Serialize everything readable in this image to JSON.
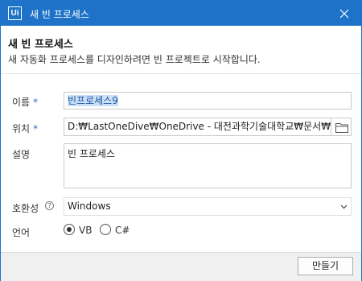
{
  "window": {
    "title": "새 빈 프로세스",
    "logo_text": "Ui"
  },
  "header": {
    "title": "새 빈 프로세스",
    "description": "새 자동화 프로세스를 디자인하려면 빈 프로젝트로 시작합니다."
  },
  "form": {
    "name": {
      "label": "이름",
      "required_mark": "*",
      "value": "빈프로세스9"
    },
    "location": {
      "label": "위치",
      "required_mark": "*",
      "value": "D:₩LastOneDive₩OneDrive - 대전과학기술대학교₩문서₩"
    },
    "description": {
      "label": "설명",
      "value": "빈 프로세스"
    },
    "compatibility": {
      "label": "호환성",
      "help_glyph": "?",
      "value": "Windows"
    },
    "language": {
      "label": "언어",
      "options": [
        {
          "label": "VB",
          "selected": true
        },
        {
          "label": "C#",
          "selected": false
        }
      ]
    }
  },
  "footer": {
    "create_label": "만들기"
  }
}
